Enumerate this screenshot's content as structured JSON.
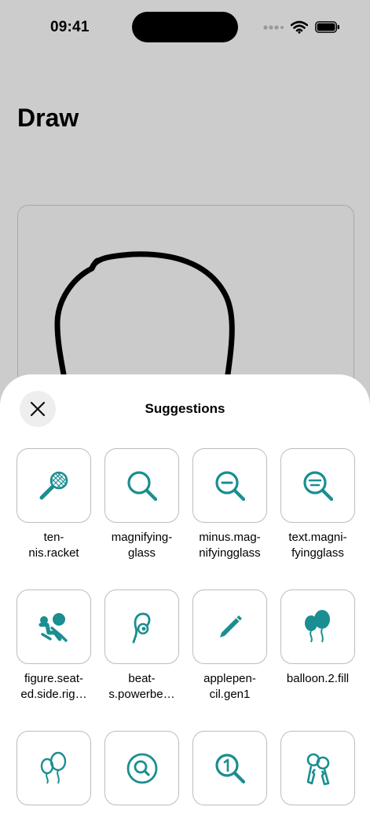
{
  "status_bar": {
    "time": "09:41",
    "icons": [
      "signal-dots-icon",
      "wifi-icon",
      "battery-icon"
    ]
  },
  "page": {
    "title": "Draw"
  },
  "sheet": {
    "title": "Suggestions",
    "close_icon": "close-icon"
  },
  "accent_color": "#1a8e91",
  "suggestions": [
    {
      "label": "ten-\nnis.racket",
      "icon": "tennis-racket-icon"
    },
    {
      "label": "magnifying-\nglass",
      "icon": "magnifying-glass-icon"
    },
    {
      "label": "minus.mag-\nnifyingglass",
      "icon": "minus-magnifying-glass-icon"
    },
    {
      "label": "text.magni-\nfyingglass",
      "icon": "text-magnifying-glass-icon"
    },
    {
      "label": "figure.seat-\ned.side.rig…",
      "icon": "figure-seated-side-icon"
    },
    {
      "label": "beat-\ns.powerbe…",
      "icon": "beats-powerbeats-icon"
    },
    {
      "label": "applepen-\ncil.gen1",
      "icon": "apple-pencil-icon"
    },
    {
      "label": "balloon.2.fill",
      "icon": "balloon-2-fill-icon"
    },
    {
      "label": "",
      "icon": "balloon-2-icon"
    },
    {
      "label": "",
      "icon": "magnifying-glass-circle-icon"
    },
    {
      "label": "",
      "icon": "number-magnifying-glass-icon"
    },
    {
      "label": "",
      "icon": "key-2-chained-icon"
    }
  ]
}
